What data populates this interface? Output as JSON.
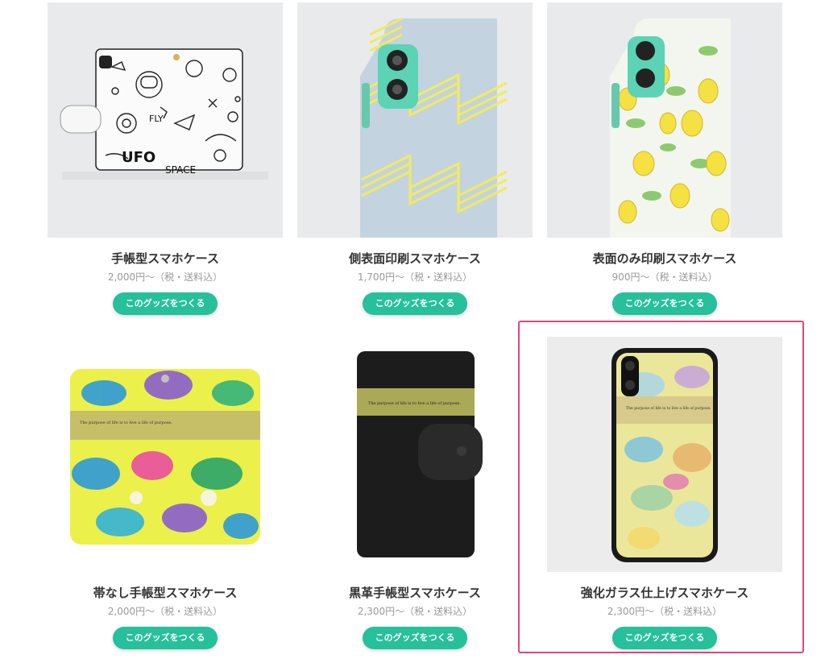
{
  "products": [
    {
      "title": "手帳型スマホケース",
      "price": "2,000円〜（税・送料込）",
      "button": "このグッズをつくる",
      "image": "notebook-case-space-doodle"
    },
    {
      "title": "側表面印刷スマホケース",
      "price": "1,700円〜（税・送料込）",
      "button": "このグッズをつくる",
      "image": "side-print-case-yellow-zigzag"
    },
    {
      "title": "表面のみ印刷スマホケース",
      "price": "900円〜（税・送料込）",
      "button": "このグッズをつくる",
      "image": "front-print-case-lemons"
    },
    {
      "title": "帯なし手帳型スマホケース",
      "price": "2,000円〜（税・送料込）",
      "button": "このグッズをつくる",
      "image": "strapless-notebook-case-floral"
    },
    {
      "title": "黒革手帳型スマホケース",
      "price": "2,300円〜（税・送料込）",
      "button": "このグッズをつくる",
      "image": "black-leather-notebook-case"
    },
    {
      "title": "強化ガラス仕上げスマホケース",
      "price": "2,300円〜（税・送料込）",
      "button": "このグッズをつくる",
      "image": "tempered-glass-case-floral"
    }
  ],
  "colors": {
    "button": "#26c09a",
    "highlight": "#e0457c"
  }
}
